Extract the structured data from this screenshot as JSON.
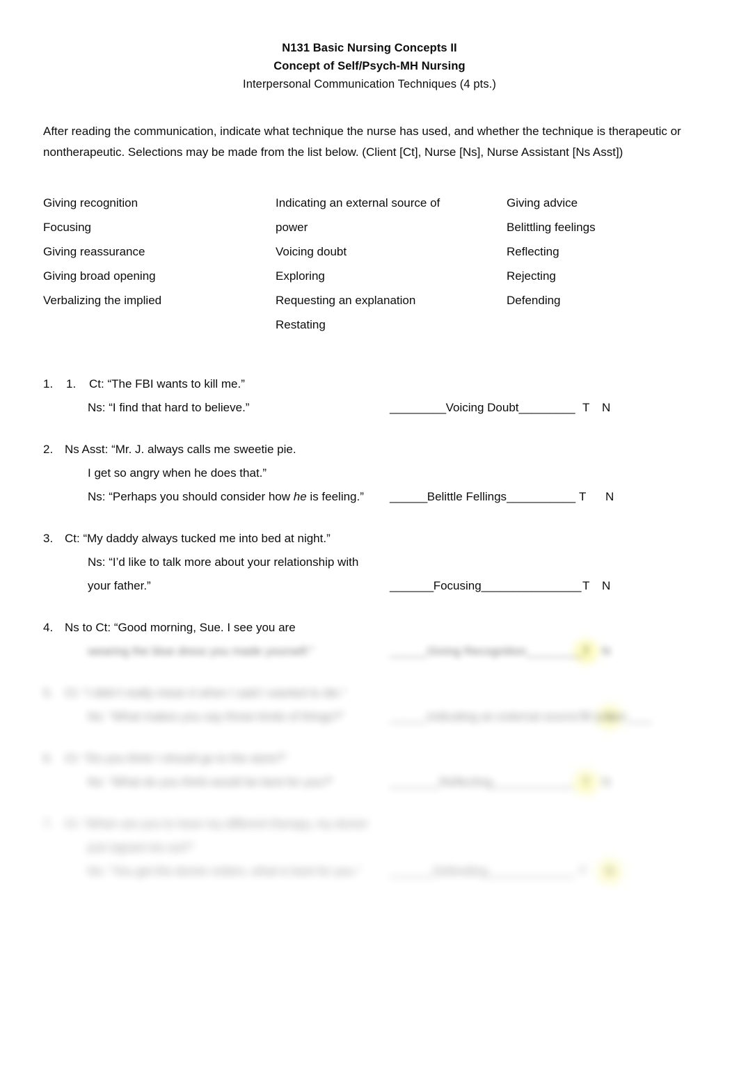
{
  "header": {
    "line1": "N131 Basic Nursing Concepts II",
    "line2": "Concept of Self/Psych-MH Nursing",
    "line3": "Interpersonal Communication Techniques (4 pts.)"
  },
  "intro": {
    "text": "After reading the communication, indicate what technique the nurse has used, and whether the technique is therapeutic or nontherapeutic. Selections may be made from the list below. (Client [Ct], Nurse [Ns], Nurse Assistant [Ns Asst])"
  },
  "term_list": {
    "column1": [
      "Giving recognition",
      "Focusing",
      "Giving reassurance",
      "Giving broad opening",
      "Verbalizing the implied"
    ],
    "column2": [
      "Indicating an external source of",
      "power",
      "Voicing doubt",
      "Exploring",
      "Requesting an explanation",
      "Restating"
    ],
    "column3": [
      "Giving advice",
      "Belittling feelings",
      "Reflecting",
      "Rejecting",
      "Defending"
    ]
  },
  "answer_options": {
    "therapeutic": "T",
    "nontherapeutic": "N"
  },
  "questions": [
    {
      "number": "1.",
      "subnumber": "1.",
      "lines": [
        {
          "indent": 0,
          "text": "Ct: “The FBI wants to kill me.”"
        },
        {
          "indent": 1,
          "text": "Ns: “I find that hard to believe.”"
        }
      ],
      "answer": {
        "prefix": "_________",
        "value": "Voicing Doubt",
        "suffix": "_________",
        "selected": "T"
      },
      "blur": 0
    },
    {
      "number": "2.",
      "lines": [
        {
          "indent": 0,
          "text": "Ns Asst: “Mr. J. always calls me sweetie pie."
        },
        {
          "indent": 1,
          "text": "I get so angry when he does that.”"
        },
        {
          "indent": 1,
          "text": "Ns: “Perhaps you should consider how he is feeling.”",
          "italic_word": "he"
        }
      ],
      "answer": {
        "prefix": "______",
        "value": "Belittle Fellings",
        "suffix": "___________",
        "selected": "N"
      },
      "blur": 0
    },
    {
      "number": "3.",
      "lines": [
        {
          "indent": 0,
          "text": "Ct: “My daddy always tucked me into bed at night.”"
        },
        {
          "indent": 1,
          "text": "Ns: “I’d like to talk more about your relationship with"
        },
        {
          "indent": 1,
          "text": "your father.”"
        }
      ],
      "answer": {
        "prefix": "_______",
        "value": "Focusing",
        "suffix": "________________",
        "selected": "T"
      },
      "blur": 0
    },
    {
      "number": "4.",
      "lines": [
        {
          "indent": 0,
          "text": "Ns to Ct: “Good morning, Sue. I see you are"
        },
        {
          "indent": 1,
          "text": "wearing the blue dress you made yourself.”",
          "blur": 2
        }
      ],
      "answer": {
        "prefix": "______",
        "value": "Giving Recognition",
        "suffix": "_________",
        "selected": "T"
      },
      "answer_blur": 2,
      "blur": 0
    },
    {
      "number": "5.",
      "lines": [
        {
          "indent": 0,
          "text": "Ct: “I didn’t really mean it when I said I wanted to die.”"
        },
        {
          "indent": 1,
          "text": "Ns: “What makes you say those kinds of things?”"
        }
      ],
      "answer": {
        "prefix": "______",
        "value": "Indicating an external source of power",
        "suffix": "____",
        "selected": "N"
      },
      "blur": 3
    },
    {
      "number": "6.",
      "lines": [
        {
          "indent": 0,
          "text": "Ct: “Do you think I should go to the store?”"
        },
        {
          "indent": 1,
          "text": "Ns: “What do you think would be best for you?”"
        }
      ],
      "answer": {
        "prefix": "________",
        "value": "Reflecting",
        "suffix": "_____________",
        "selected": "T"
      },
      "blur": 3
    },
    {
      "number": "7.",
      "lines": [
        {
          "indent": 0,
          "text": "Ct: “When are you to have my different therapy, my doctor"
        },
        {
          "indent": 1,
          "text": "just signed me out?”"
        },
        {
          "indent": 1,
          "text": "Ns: “You get the doctor orders, what is best for you.”"
        }
      ],
      "answer": {
        "prefix": "_______",
        "value": "Defending",
        "suffix": "______________",
        "selected": "N"
      },
      "blur": 4
    }
  ]
}
